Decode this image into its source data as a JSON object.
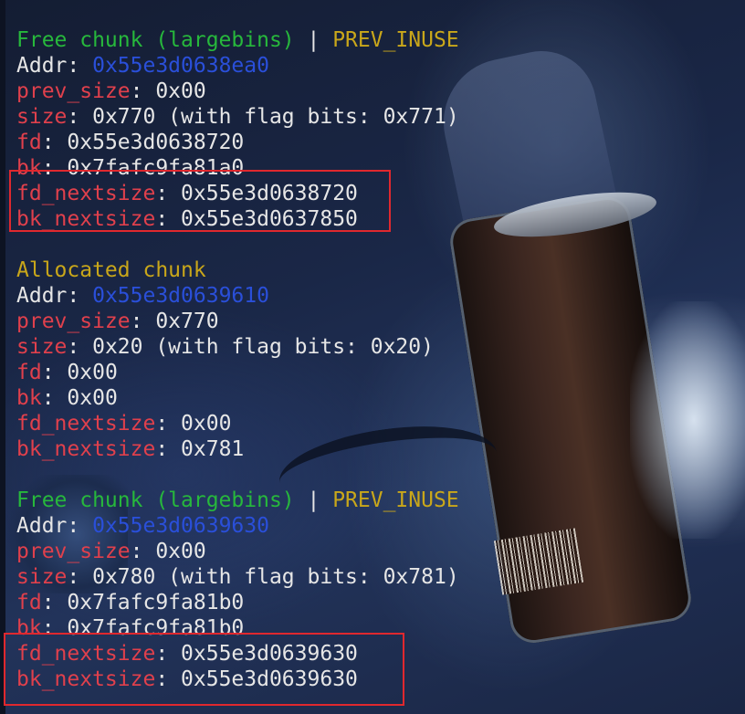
{
  "chunks": [
    {
      "type_label": "Free chunk (largebins)",
      "separator": " | ",
      "flag_label": "PREV_INUSE",
      "addr_label": "Addr",
      "addr": "0x55e3d0638ea0",
      "prev_size_label": "prev_size",
      "prev_size": "0x00",
      "size_label": "size",
      "size": "0x770 (with flag bits: 0x771)",
      "fd_label": "fd",
      "fd": "0x55e3d0638720",
      "bk_label": "bk",
      "bk": "0x7fafc9fa81a0",
      "fd_nextsize_label": "fd_nextsize",
      "fd_nextsize": "0x55e3d0638720",
      "bk_nextsize_label": "bk_nextsize",
      "bk_nextsize": "0x55e3d0637850"
    },
    {
      "type_label": "Allocated chunk",
      "addr_label": "Addr",
      "addr": "0x55e3d0639610",
      "prev_size_label": "prev_size",
      "prev_size": "0x770",
      "size_label": "size",
      "size": "0x20 (with flag bits: 0x20)",
      "fd_label": "fd",
      "fd": "0x00",
      "bk_label": "bk",
      "bk": "0x00",
      "fd_nextsize_label": "fd_nextsize",
      "fd_nextsize": "0x00",
      "bk_nextsize_label": "bk_nextsize",
      "bk_nextsize": "0x781"
    },
    {
      "type_label": "Free chunk (largebins)",
      "separator": " | ",
      "flag_label": "PREV_INUSE",
      "addr_label": "Addr",
      "addr": "0x55e3d0639630",
      "prev_size_label": "prev_size",
      "prev_size": "0x00",
      "size_label": "size",
      "size": "0x780 (with flag bits: 0x781)",
      "fd_label": "fd",
      "fd": "0x7fafc9fa81b0",
      "bk_label": "bk",
      "bk": "0x7fafc9fa81b0",
      "fd_nextsize_label": "fd_nextsize",
      "fd_nextsize": "0x55e3d0639630",
      "bk_nextsize_label": "bk_nextsize",
      "bk_nextsize": "0x55e3d0639630"
    }
  ],
  "colors": {
    "free_label": "#27b83c",
    "flag_label": "#c9a71a",
    "address": "#2a4fd9",
    "field_name": "#e0404c",
    "highlight_box": "#e0282e"
  }
}
